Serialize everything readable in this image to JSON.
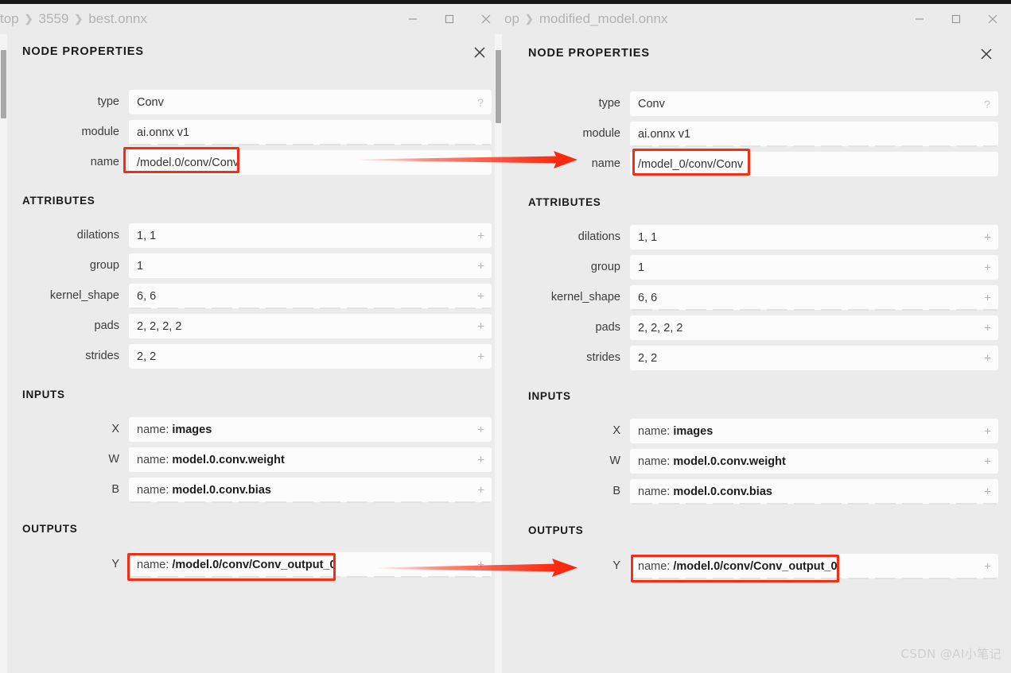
{
  "windows": [
    {
      "id": "left",
      "breadcrumb": [
        "top",
        "3559",
        "best.onnx"
      ],
      "breadcrumb_separator": "❯",
      "titlebar_buttons": [
        {
          "name": "minimize-button",
          "glyph": "minimize"
        },
        {
          "name": "maximize-button",
          "glyph": "maximize"
        },
        {
          "name": "close-window-button",
          "glyph": "close"
        }
      ],
      "panel": {
        "title": "NODE PROPERTIES",
        "close_label": "×",
        "properties": [
          {
            "label": "type",
            "value": "Conv",
            "affordance": "?"
          },
          {
            "label": "module",
            "value": "ai.onnx v1",
            "affordance": ""
          },
          {
            "label": "name",
            "value": "/model.0/conv/Conv",
            "affordance": ""
          }
        ],
        "attributes_title": "ATTRIBUTES",
        "attributes": [
          {
            "label": "dilations",
            "value": "1, 1",
            "affordance": "+"
          },
          {
            "label": "group",
            "value": "1",
            "affordance": "+"
          },
          {
            "label": "kernel_shape",
            "value": "6, 6",
            "affordance": "+"
          },
          {
            "label": "pads",
            "value": "2, 2, 2, 2",
            "affordance": "+"
          },
          {
            "label": "strides",
            "value": "2, 2",
            "affordance": "+"
          }
        ],
        "inputs_title": "INPUTS",
        "inputs": [
          {
            "label": "X",
            "key": "name:",
            "value": "images",
            "affordance": "+"
          },
          {
            "label": "W",
            "key": "name:",
            "value": "model.0.conv.weight",
            "affordance": "+"
          },
          {
            "label": "B",
            "key": "name:",
            "value": "model.0.conv.bias",
            "affordance": "+"
          }
        ],
        "outputs_title": "OUTPUTS",
        "outputs": [
          {
            "label": "Y",
            "key": "name:",
            "value": "/model.0/conv/Conv_output_0",
            "affordance": "+"
          }
        ]
      }
    },
    {
      "id": "right",
      "breadcrumb": [
        "op",
        "modified_model.onnx"
      ],
      "breadcrumb_separator": "❯",
      "titlebar_buttons": [
        {
          "name": "minimize-button",
          "glyph": "minimize"
        },
        {
          "name": "maximize-button",
          "glyph": "maximize"
        },
        {
          "name": "close-window-button",
          "glyph": "close"
        }
      ],
      "panel": {
        "title": "NODE PROPERTIES",
        "close_label": "×",
        "properties": [
          {
            "label": "type",
            "value": "Conv",
            "affordance": "?"
          },
          {
            "label": "module",
            "value": "ai.onnx v1",
            "affordance": ""
          },
          {
            "label": "name",
            "value": "/model_0/conv/Conv",
            "affordance": ""
          }
        ],
        "attributes_title": "ATTRIBUTES",
        "attributes": [
          {
            "label": "dilations",
            "value": "1, 1",
            "affordance": "+"
          },
          {
            "label": "group",
            "value": "1",
            "affordance": "+"
          },
          {
            "label": "kernel_shape",
            "value": "6, 6",
            "affordance": "+"
          },
          {
            "label": "pads",
            "value": "2, 2, 2, 2",
            "affordance": "+"
          },
          {
            "label": "strides",
            "value": "2, 2",
            "affordance": "+"
          }
        ],
        "inputs_title": "INPUTS",
        "inputs": [
          {
            "label": "X",
            "key": "name:",
            "value": "images",
            "affordance": "+"
          },
          {
            "label": "W",
            "key": "name:",
            "value": "model.0.conv.weight",
            "affordance": "+"
          },
          {
            "label": "B",
            "key": "name:",
            "value": "model.0.conv.bias",
            "affordance": "+"
          }
        ],
        "outputs_title": "OUTPUTS",
        "outputs": [
          {
            "label": "Y",
            "key": "name:",
            "value": "/model.0/conv/Conv_output_0",
            "affordance": "+"
          }
        ]
      }
    }
  ],
  "annotations": {
    "highlight_color": "#f42d14",
    "arrow_color": "#fa2a10",
    "highlight_count": 4,
    "arrow_count": 2
  },
  "watermark": "CSDN @AI小笔记"
}
